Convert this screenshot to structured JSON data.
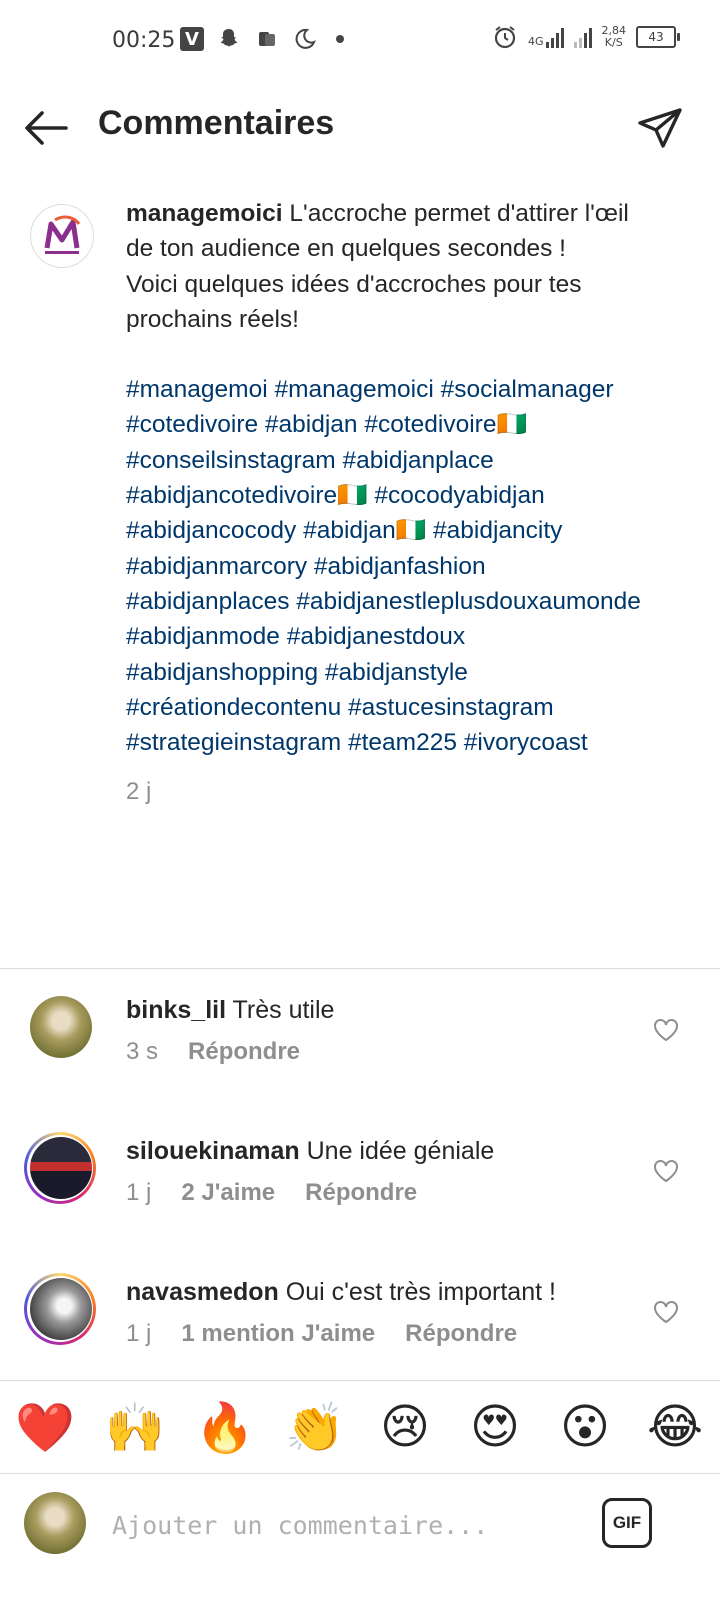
{
  "status_bar": {
    "time": "00:25",
    "network": "4G",
    "speed_value": "2,84",
    "speed_unit": "K/S",
    "battery": "43"
  },
  "header": {
    "title": "Commentaires"
  },
  "caption": {
    "username": "managemoici",
    "text_lines": [
      "L'accroche permet d'attirer l'œil de ton audience en quelques secondes !",
      "Voici quelques idées d'accroches pour tes prochains réels!"
    ],
    "hashtags": "#managemoi #managemoici #socialmanager #cotedivoire #abidjan #cotedivoire🇨🇮 #conseilsinstagram #abidjanplace #abidjancotedivoire🇨🇮 #cocodyabidjan #abidjancocody #abidjan🇨🇮 #abidjancity #abidjanmarcory #abidjanfashion #abidjanplaces #abidjanestleplusdouxaumonde #abidjanmode #abidjanestdoux #abidjanshopping #abidjanstyle #créationdecontenu #astucesinstagram #strategieinstagram #team225 #ivorycoast",
    "time": "2 j"
  },
  "comments": [
    {
      "username": "binks_lil",
      "text": "Très utile",
      "time": "3 s",
      "likes": "",
      "reply": "Répondre"
    },
    {
      "username": "silouekinaman",
      "text": "Une idée géniale",
      "time": "1 j",
      "likes": "2 J'aime",
      "reply": "Répondre"
    },
    {
      "username": "navasmedon",
      "text": "Oui c'est très important !",
      "time": "1 j",
      "likes": "1 mention J'aime",
      "reply": "Répondre"
    }
  ],
  "reactions": [
    "❤️",
    "🙌",
    "🔥",
    "👏",
    "😢",
    "😍",
    "😮",
    "😂"
  ],
  "input": {
    "placeholder": "Ajouter un commentaire...",
    "gif_label": "GIF"
  }
}
